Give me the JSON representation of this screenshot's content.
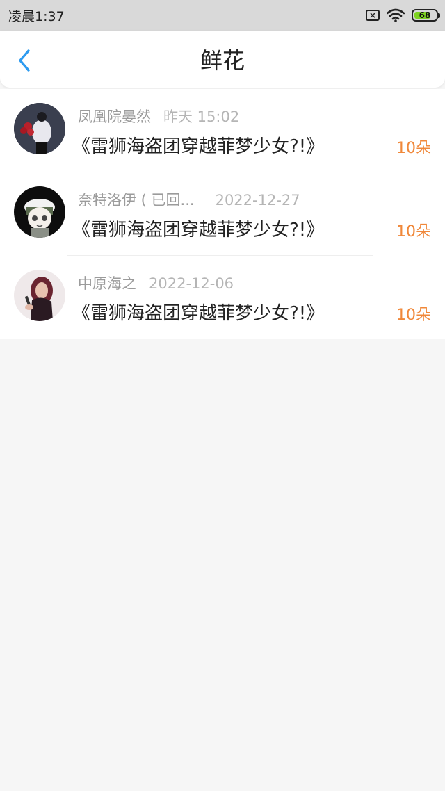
{
  "status_bar": {
    "time": "凌晨1:37",
    "battery": "68",
    "icons": [
      "sim-x-icon",
      "wifi-icon",
      "battery-icon"
    ]
  },
  "header": {
    "title": "鲜花",
    "back_icon": "chevron-left-icon"
  },
  "colors": {
    "accent": "#2d9bf0",
    "flower_count": "#f0883a",
    "status_bg": "#d9d9d9",
    "page_bg": "#f6f6f6"
  },
  "items": [
    {
      "name": "凤凰院晏然",
      "time": "昨天 15:02",
      "book": "《雷狮海盗团穿越菲梦少女?!》",
      "count": "10朵"
    },
    {
      "name": "奈特洛伊 ( 已回...",
      "time": "2022-12-27",
      "book": "《雷狮海盗团穿越菲梦少女?!》",
      "count": "10朵"
    },
    {
      "name": "中原海之",
      "time": "2022-12-06",
      "book": "《雷狮海盗团穿越菲梦少女?!》",
      "count": "10朵"
    }
  ]
}
